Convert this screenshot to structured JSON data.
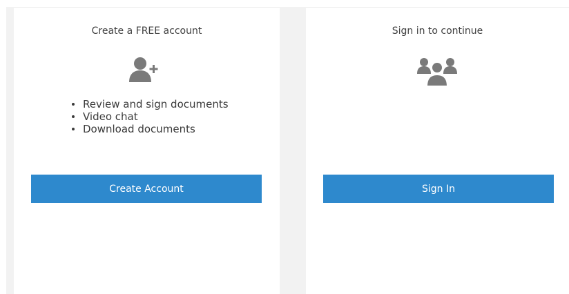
{
  "create_panel": {
    "title": "Create a FREE account",
    "icon": "add-user-icon",
    "features": [
      "Review and sign documents",
      "Video chat",
      "Download documents"
    ],
    "button_label": "Create Account"
  },
  "signin_panel": {
    "title": "Sign in to continue",
    "icon": "users-group-icon",
    "button_label": "Sign In"
  },
  "colors": {
    "button": "#2e89cd",
    "icon": "#7a7a7a",
    "text": "#404040",
    "background_gutter": "#f2f2f2"
  }
}
